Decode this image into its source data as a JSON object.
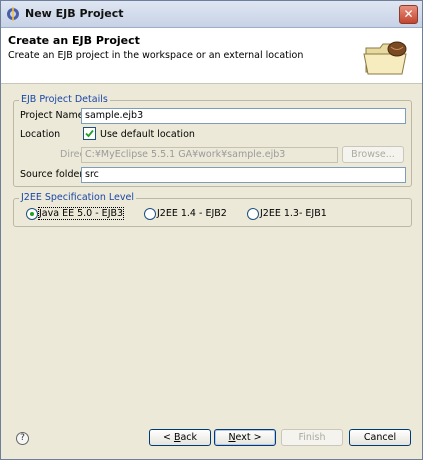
{
  "window": {
    "title": "New EJB Project"
  },
  "header": {
    "title": "Create an EJB Project",
    "description": "Create an EJB project in the workspace or an external location"
  },
  "details_group": {
    "label": "EJB Project Details",
    "project_name_label": "Project Name",
    "project_name_value": "sample.ejb3",
    "location_label": "Location",
    "use_default_label": "Use default location",
    "use_default_checked": true,
    "directory_label": "Directory",
    "directory_value": "C:¥MyEclipse 5.5.1 GA¥work¥sample.ejb3",
    "browse_label": "Browse...",
    "source_folder_label": "Source folder",
    "source_folder_value": "src"
  },
  "spec_group": {
    "label": "J2EE Specification Level",
    "options": [
      {
        "label": "Java EE 5.0 - EJB3",
        "selected": true
      },
      {
        "label": "J2EE 1.4 - EJB2",
        "selected": false
      },
      {
        "label": "J2EE 1.3- EJB1",
        "selected": false
      }
    ]
  },
  "footer": {
    "help_glyph": "?",
    "back_prefix": "< ",
    "back_mnemonic": "B",
    "back_rest": "ack",
    "next_mnemonic": "N",
    "next_rest": "ext >",
    "finish_label": "Finish",
    "cancel_label": "Cancel"
  },
  "colors": {
    "group_label": "#1a46a8",
    "radio_selected": "#21a121",
    "dialog_bg": "#ece9d8"
  }
}
